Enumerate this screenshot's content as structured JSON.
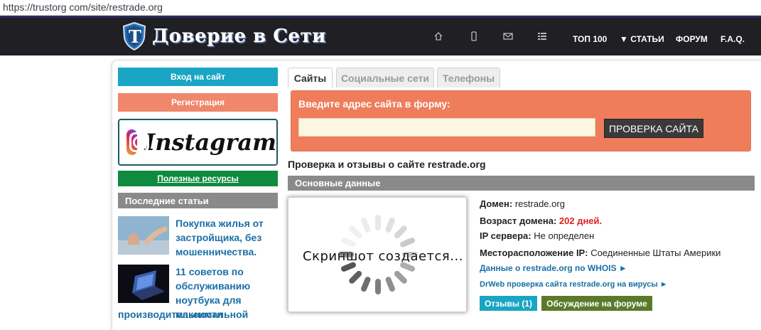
{
  "browser": {
    "url": "https://trustorg com/site/restrade.org"
  },
  "nav": {
    "logo_text": "Доверие в Сети",
    "logo_letter": "T",
    "icons": [
      "home-icon",
      "mobile-icon",
      "mail-icon",
      "list-icon"
    ],
    "links": {
      "top100": "ТОП 100",
      "articles": "▼ СТАТЬИ",
      "forum": "ФОРУМ",
      "faq": "F.A.Q."
    }
  },
  "sidebar": {
    "login": "Вход на сайт",
    "register": "Регистрация",
    "instagram": "Instagram",
    "resources": "Полезные ресурсы",
    "latest_title": "Последние статьи",
    "articles": [
      {
        "title": "Покупка жилья от застройщика, без мошенничества."
      },
      {
        "title": "11 советов по обслуживанию ноутбука для максимальной",
        "title_cont": "производительности"
      }
    ]
  },
  "tabs": {
    "sites": "Сайты",
    "social": "Социальные сети",
    "phones": "Телефоны"
  },
  "check": {
    "label": "Введите адрес сайта в форму:",
    "input_value": "",
    "button": "ПРОВЕРКА САЙТА"
  },
  "page_title": "Проверка и отзывы о сайте restrade.org",
  "section_title": "Основные данные",
  "screenshot": {
    "text": "Скриншот создается..."
  },
  "info": {
    "domain_label": "Домен:",
    "domain_value": "restrade.org",
    "age_label": "Возраст домена:",
    "age_value": "202 дней.",
    "ip_label": "IP сервера:",
    "ip_value": "Не определен",
    "location_label": "Месторасположение IP:",
    "location_value": "Соединенные Штаты Америки",
    "whois_link": "Данные о restrade.org по WHOIS ►",
    "drweb_link": "DrWeb проверка сайта restrade.org на вирусы ►"
  },
  "buttons": {
    "reviews": "Отзывы (1)",
    "forum_discussion": "Обсуждение на форуме"
  },
  "colors": {
    "nav_bg": "#1f1f24",
    "login": "#1aa5c4",
    "register": "#f0876a",
    "resources": "#0f8a3e",
    "check_bg": "#ef7d5c",
    "link": "#1a6fa6",
    "age_red": "#e02020"
  }
}
